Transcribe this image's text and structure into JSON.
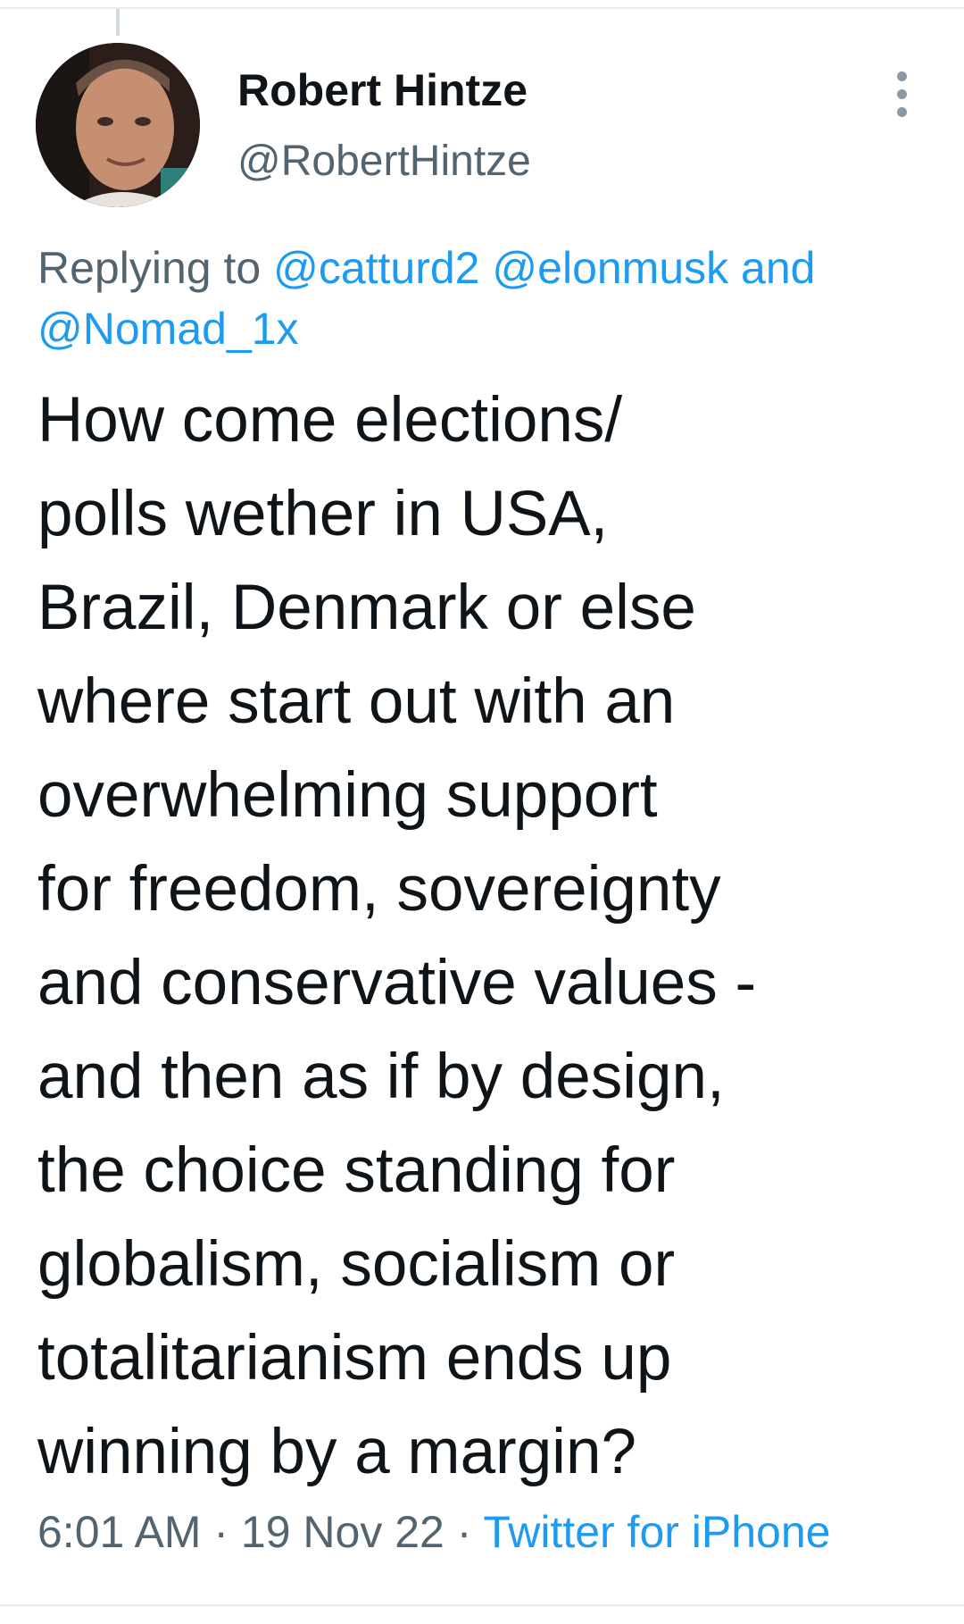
{
  "author": {
    "display_name": "Robert Hintze",
    "handle": "@RobertHintze"
  },
  "reply_context": {
    "prefix": "Replying to",
    "mentions": [
      "@catturd2",
      "@elonmusk",
      "@Nomad_1x"
    ],
    "conjunction": "and"
  },
  "tweet": {
    "text": "How come elections/\npolls wether in USA,\nBrazil, Denmark or else\nwhere start out with an\noverwhelming support\nfor freedom, sovereignty\nand conservative values -\nand then as if by design,\nthe choice standing for\nglobalism, socialism or\ntotalitarianism ends up\nwinning by a margin?"
  },
  "meta": {
    "time": "6:01 AM",
    "separator": "·",
    "date": "19 Nov 22",
    "source": "Twitter for iPhone"
  },
  "icons": {
    "more": "more-vertical-icon"
  },
  "colors": {
    "link": "#1d9bf0",
    "secondary_text": "#536471",
    "primary_text": "#0f1419"
  }
}
